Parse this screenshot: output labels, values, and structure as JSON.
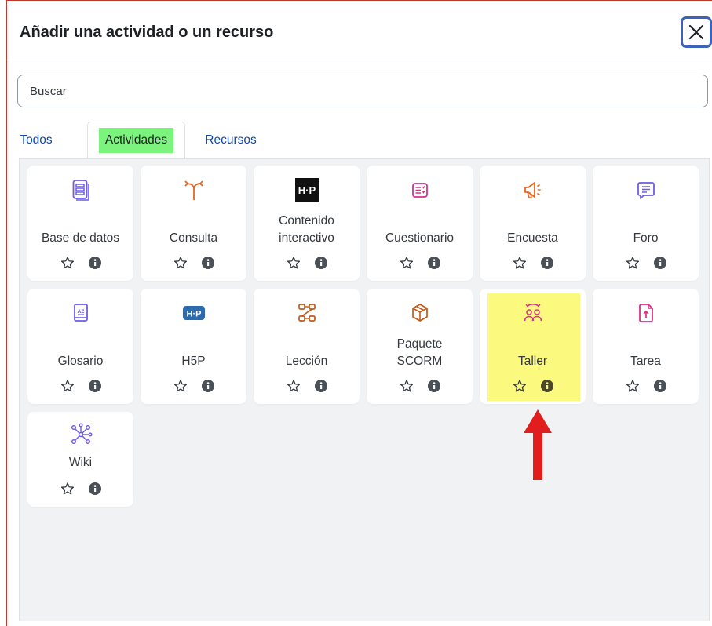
{
  "modal": {
    "title": "Añadir una actividad o un recurso",
    "close_icon": "close-icon"
  },
  "search": {
    "placeholder": "Buscar",
    "value": ""
  },
  "tabs": [
    {
      "label": "Todos",
      "active": false
    },
    {
      "label": "Actividades",
      "active": true
    },
    {
      "label": "Recursos",
      "active": false
    }
  ],
  "cards": [
    {
      "label": "Base de datos",
      "icon": "database-icon",
      "color": "#6d5ce7"
    },
    {
      "label": "Consulta",
      "icon": "choice-icon",
      "color": "#e8661d"
    },
    {
      "label": "Contenido\ninteractivo",
      "icon": "h5p-icon",
      "color": "#111111"
    },
    {
      "label": "Cuestionario",
      "icon": "quiz-icon",
      "color": "#d6338a"
    },
    {
      "label": "Encuesta",
      "icon": "megaphone-icon",
      "color": "#e8661d"
    },
    {
      "label": "Foro",
      "icon": "forum-icon",
      "color": "#6d5ce7"
    },
    {
      "label": "Glosario",
      "icon": "glossary-icon",
      "color": "#6d5ce7"
    },
    {
      "label": "H5P",
      "icon": "h5p-icon",
      "color": "#2b6cb0"
    },
    {
      "label": "Lección",
      "icon": "lesson-icon",
      "color": "#c25a18"
    },
    {
      "label": "Paquete\nSCORM",
      "icon": "package-icon",
      "color": "#c25a18"
    },
    {
      "label": "Taller",
      "icon": "workshop-icon",
      "color": "#d6338a",
      "highlighted": true
    },
    {
      "label": "Tarea",
      "icon": "assignment-icon",
      "color": "#d6338a"
    },
    {
      "label": "Wiki",
      "icon": "wiki-icon",
      "color": "#6d5ce7"
    }
  ],
  "card_actions": {
    "star_icon": "star-icon",
    "info_icon": "info-icon"
  },
  "annotation": {
    "arrow_icon": "arrow-up-icon",
    "color": "#e11d1d"
  },
  "colors": {
    "accent_link": "#0f47ad",
    "active_tab_highlight": "#7cf37c",
    "highlight_card": "#fbf97e"
  }
}
